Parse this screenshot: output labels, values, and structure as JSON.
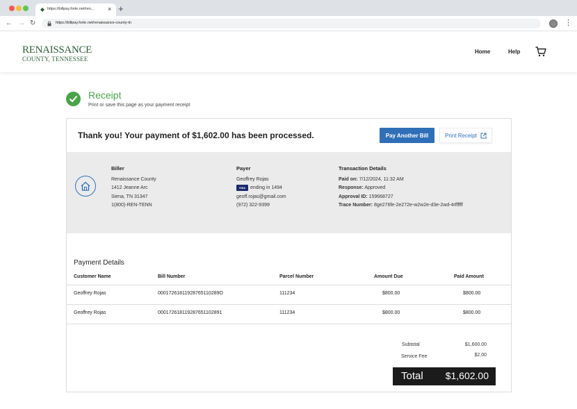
{
  "browser": {
    "tab_title": "https://billpay.forte.net/ren...",
    "tab_close": "×",
    "new_tab": "+",
    "url": "https://billpay.forte.net/renaissance-county-tn",
    "back": "←",
    "forward": "→",
    "reload": "↻",
    "menu": "⋮"
  },
  "site": {
    "logo_line1": "RENAISSANCE",
    "logo_line2": "COUNTY, TENNESSEE",
    "nav": [
      "Home",
      "Help"
    ]
  },
  "receipt": {
    "title": "Receipt",
    "subtitle": "Print or save this page as your payment receipt"
  },
  "card": {
    "thanks": "Thank you! Your payment of $1,602.00 has been processed.",
    "pay_another_label": "Pay Another Bill",
    "print_receipt_label": "Print Receipt"
  },
  "biller": {
    "heading": "Biller",
    "lines": [
      "Renaissance County",
      "1412 Jeanne Arc",
      "Siena, TN 31347",
      "1(800)-REN-TENN"
    ]
  },
  "payer": {
    "heading": "Payer",
    "name": "Geoffrey Rojas",
    "card_brand": "VISA",
    "card_ending": "ending in 1494",
    "email": "geoff.rojas@gmail.com",
    "phone": "(972) 322-9399"
  },
  "transaction": {
    "heading": "Transaction Details",
    "paid_on_label": "Paid on:",
    "paid_on_value": "7/12/2024, 11:32 AM",
    "response_label": "Response:",
    "response_value": "Approved",
    "approval_label": "Approval ID:",
    "approval_value": "159668727",
    "trace_label": "Trace Number:",
    "trace_value": "8ge276fe-2e272e-w2w2e-d3e-2wd-4rffffff"
  },
  "payment_details": {
    "title": "Payment Details",
    "columns": [
      "Customer Name",
      "Bill Number",
      "Parcel Number",
      "Amount Due",
      "Paid Amount"
    ],
    "rows": [
      [
        "Geoffrey Rojas",
        "00017261811928765110289O",
        "111234",
        "$800.00",
        "$800.00"
      ],
      [
        "Geoffrey Rojas",
        "000172618119287651102891",
        "111234",
        "$800.00",
        "$800.00"
      ]
    ]
  },
  "summary": {
    "subtotal_label": "Subtotal",
    "subtotal_value": "$1,600.00",
    "fee_label": "Service Fee",
    "fee_value": "$2.00",
    "total_label": "Total",
    "total_value": "$1,602.00"
  },
  "colors": {
    "brand_green": "#4aa34a",
    "primary_blue": "#2f6fb7",
    "total_bg": "#1b1b1b"
  }
}
